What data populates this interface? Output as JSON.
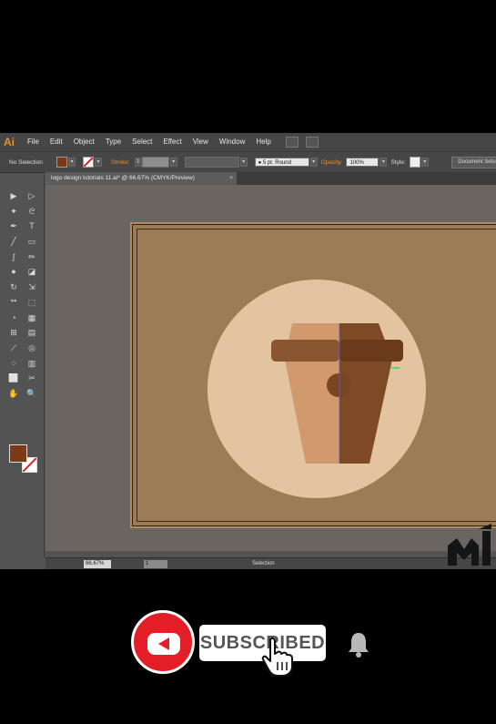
{
  "app": {
    "logo": "Ai",
    "menu": [
      "File",
      "Edit",
      "Object",
      "Type",
      "Select",
      "Effect",
      "View",
      "Window",
      "Help"
    ]
  },
  "control_bar": {
    "selection_state": "No Selection",
    "stroke_label": "Stroke:",
    "brush": "5 pt. Round",
    "opacity_label": "Opacity:",
    "opacity_value": "100%",
    "style_label": "Style:",
    "document_setup": "Document Setup"
  },
  "document": {
    "tab_title": "logo design tutorials 11.ai* @ 66.67% (CMYK/Preview)",
    "close": "×"
  },
  "status": {
    "zoom": "66.67%",
    "page": "1",
    "status_text": "Selection"
  },
  "tools": [
    "selection-tool-icon",
    "direct-selection-tool-icon",
    "magic-wand-icon",
    "lasso-icon",
    "pen-tool-icon",
    "type-tool-icon",
    "line-tool-icon",
    "rectangle-tool-icon",
    "paintbrush-icon",
    "pencil-icon",
    "blob-brush-icon",
    "eraser-icon",
    "rotate-icon",
    "scale-icon",
    "width-tool-icon",
    "free-transform-icon",
    "shape-builder-icon",
    "perspective-grid-icon",
    "mesh-icon",
    "gradient-icon",
    "eyedropper-icon",
    "blend-icon",
    "symbol-sprayer-icon",
    "column-graph-icon",
    "artboard-tool-icon",
    "slice-tool-icon",
    "hand-tool-icon",
    "zoom-tool-icon"
  ],
  "tool_glyphs": [
    "▶",
    "▷",
    "✦",
    "ᘓ",
    "✒",
    "T",
    "╱",
    "▭",
    "ʃ",
    "✏",
    "●",
    "◪",
    "↻",
    "⇲",
    "ᕯ",
    "⬚",
    "◔",
    "▦",
    "⊞",
    "▤",
    "⟋",
    "◎",
    "⁘",
    "▥",
    "⬜",
    "✂",
    "✋",
    "🔍"
  ],
  "colors": {
    "fill": "#7a3a18",
    "accent": "#e8902a",
    "artboard": "#9c7b56",
    "badge_circle": "#e3c3a0",
    "cup_light": "#d09a6c",
    "cup_dark": "#7d4a25",
    "lid_light": "#8a5632",
    "lid_dark": "#6a3a1a"
  },
  "overlay": {
    "subscribe_label": "SUBSCRIBED"
  }
}
